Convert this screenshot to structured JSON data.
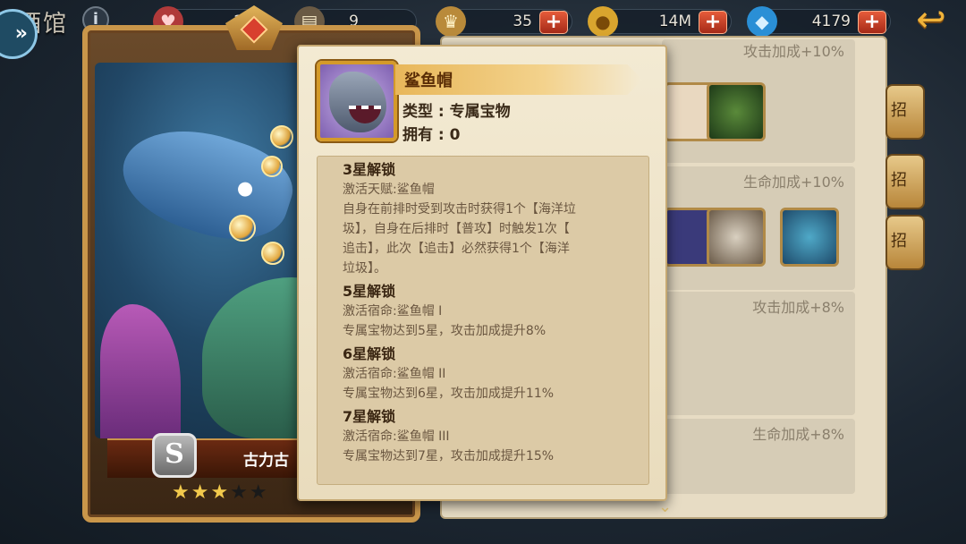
{
  "hud": {
    "title": "酒馆",
    "info_label": "i",
    "resources": [
      {
        "icon": "heart-coin-icon",
        "value": "20"
      },
      {
        "icon": "scroll-icon",
        "value": "9"
      },
      {
        "icon": "trophy-icon",
        "value": "35"
      },
      {
        "icon": "gold-coin-icon",
        "value": "14M"
      },
      {
        "icon": "gem-icon",
        "value": "4179"
      }
    ],
    "plus_label": "+",
    "back_label": "↩",
    "skip_label": "»"
  },
  "hero": {
    "rank": "S",
    "name": "古力古",
    "stars_on": "★★★",
    "stars_off": "★★",
    "star_count": 3,
    "star_max": 5
  },
  "right_panel": {
    "bonus_rows": [
      {
        "label": "攻击加成+10%"
      },
      {
        "label": "生命加成+10%"
      },
      {
        "label": "攻击加成+8%"
      },
      {
        "label": "生命加成+8%"
      }
    ],
    "side_buttons": [
      "招",
      "招",
      "招"
    ]
  },
  "popup": {
    "item_name": "鲨鱼帽",
    "type_line": "类型 : 专属宝物",
    "own_line": "拥有 : 0",
    "tiers": [
      {
        "title": "3星解锁",
        "lines": [
          "激活天赋:鲨鱼帽",
          "自身在前排时受到攻击时获得1个【海洋垃",
          "圾】，自身在后排时【普攻】时触发1次【",
          "追击】，此次【追击】必然获得1个【海洋",
          "垃圾】。"
        ]
      },
      {
        "title": "5星解锁",
        "lines": [
          "激活宿命:鲨鱼帽 I",
          "专属宝物达到5星，攻击加成提升8%"
        ]
      },
      {
        "title": "6星解锁",
        "lines": [
          "激活宿命:鲨鱼帽 II",
          "专属宝物达到6星，攻击加成提升11%"
        ]
      },
      {
        "title": "7星解锁",
        "lines": [
          "激活宿命:鲨鱼帽 III",
          "专属宝物达到7星，攻击加成提升15%"
        ]
      }
    ],
    "scroll_hint": "⌄"
  }
}
